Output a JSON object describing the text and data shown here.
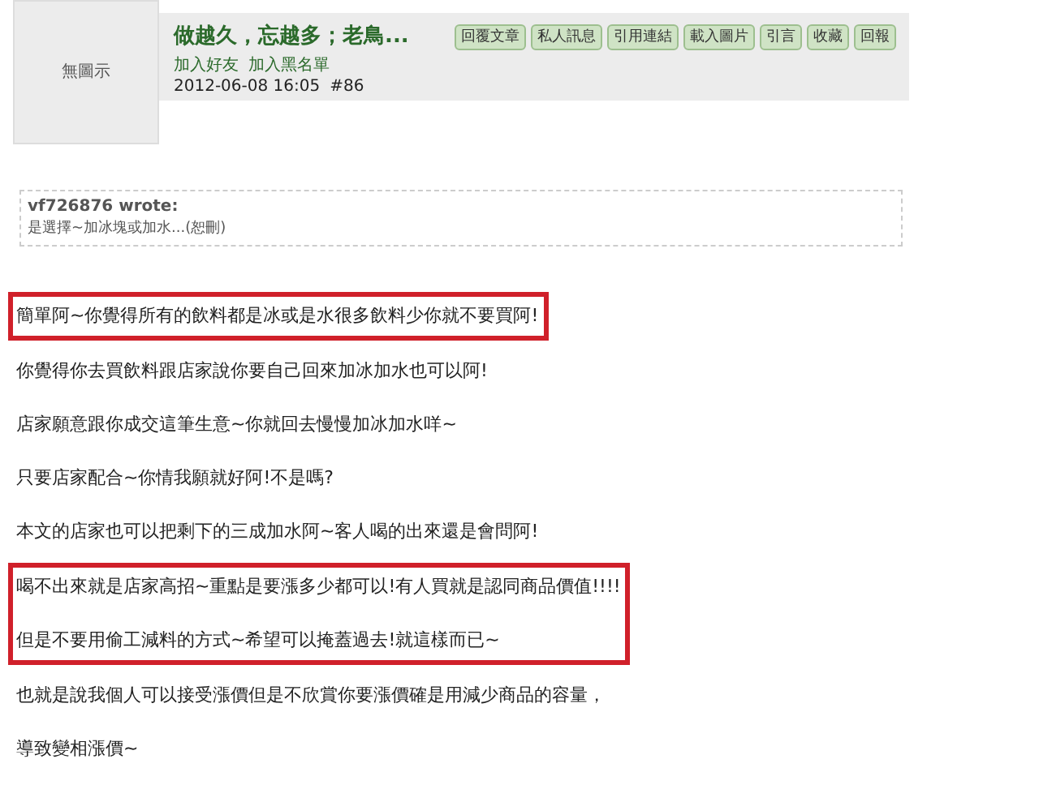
{
  "avatar": {
    "text": "無圖示"
  },
  "post_header": {
    "title": "做越久，忘越多；老鳥...",
    "links": [
      "加入好友",
      "加入黑名單"
    ],
    "date": "2012-06-08 16:05",
    "number": "#86"
  },
  "buttons": [
    "回覆文章",
    "私人訊息",
    "引用連結",
    "載入圖片",
    "引言",
    "收藏",
    "回報"
  ],
  "quote": {
    "author": "vf726876 wrote:",
    "text": "是選擇~加冰塊或加水...(恕刪)"
  },
  "blocks": [
    {
      "highlighted": true,
      "paragraphs": [
        "簡單阿~你覺得所有的飲料都是冰或是水很多飲料少你就不要買阿!"
      ]
    },
    {
      "highlighted": false,
      "paragraphs": [
        "你覺得你去買飲料跟店家說你要自己回來加冰加水也可以阿!",
        "店家願意跟你成交這筆生意~你就回去慢慢加冰加水咩~",
        "只要店家配合~你情我願就好阿!不是嗎?",
        "本文的店家也可以把剩下的三成加水阿~客人喝的出來還是會問阿!"
      ]
    },
    {
      "highlighted": true,
      "paragraphs": [
        "喝不出來就是店家高招~重點是要漲多少都可以!有人買就是認同商品價值!!!!",
        "但是不要用偷工減料的方式~希望可以掩蓋過去!就這樣而已~"
      ]
    },
    {
      "highlighted": false,
      "paragraphs": [
        "也就是說我個人可以接受漲價但是不欣賞你要漲價確是用減少商品的容量，",
        "導致變相漲價~"
      ]
    }
  ]
}
